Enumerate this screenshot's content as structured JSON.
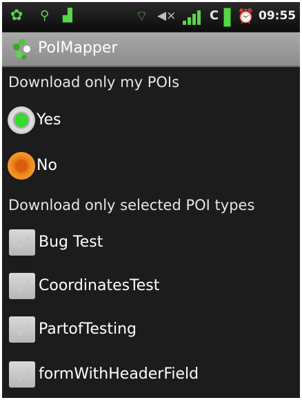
{
  "status_bar": {
    "left_icons": [
      "app-notification-icon",
      "usb-icon",
      "android-icon"
    ],
    "right_icons": [
      "wifi-icon",
      "mute-icon",
      "signal-icon",
      "battery-icon",
      "alarm-icon"
    ],
    "carrier_letter": "C",
    "time": "09:55",
    "accent_color": "#58d64a"
  },
  "title_bar": {
    "title": "PoIMapper",
    "icon": "poimapper-logo-icon"
  },
  "settings": {
    "download_mine_header": "Download only my POIs",
    "options": [
      {
        "label": "Yes",
        "selected": true
      },
      {
        "label": "No",
        "selected": false,
        "focused": true
      }
    ],
    "download_types_header": "Download only selected POI types",
    "poi_types": [
      {
        "label": "Bug Test",
        "checked": true
      },
      {
        "label": "CoordinatesTest",
        "checked": true
      },
      {
        "label": "PartofTesting",
        "checked": true
      },
      {
        "label": "formWithHeaderField",
        "checked": true
      }
    ]
  }
}
